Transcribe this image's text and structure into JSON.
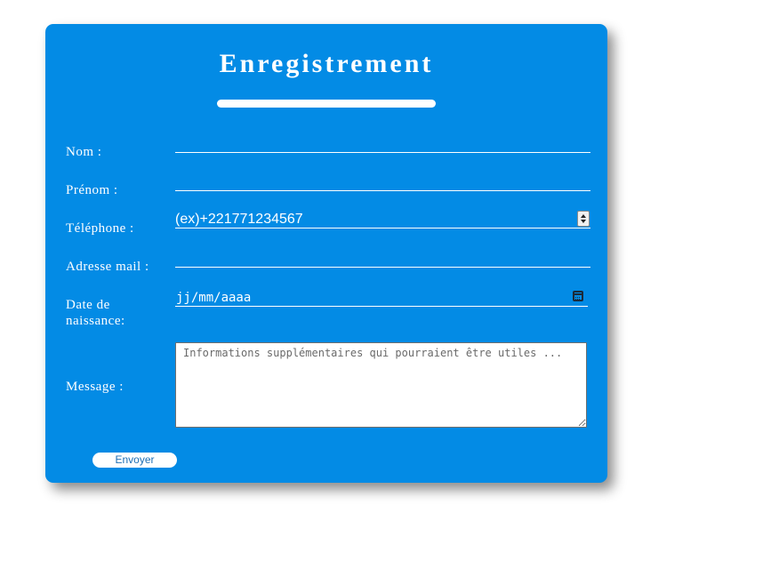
{
  "form": {
    "title": "Enregistrement",
    "fields": {
      "nom": {
        "label": "Nom :",
        "value": ""
      },
      "prenom": {
        "label": "Prénom :",
        "value": ""
      },
      "telephone": {
        "label": "Téléphone :",
        "value": "(ex)+221771234567"
      },
      "email": {
        "label": "Adresse mail :",
        "value": ""
      },
      "date_naissance": {
        "label_line1": "Date de",
        "label_line2": "naissance:",
        "placeholder": "jj/mm/aaaa"
      },
      "message": {
        "label": "Message :",
        "placeholder": "Informations supplémentaires qui pourraient être utiles ..."
      }
    },
    "submit_label": "Envoyer"
  },
  "colors": {
    "card_background": "#038be5",
    "text": "#ffffff",
    "button_text": "#1d6fb5"
  },
  "icons": {
    "date": "calendar-icon",
    "telephone": "spinner-arrows-icon"
  }
}
